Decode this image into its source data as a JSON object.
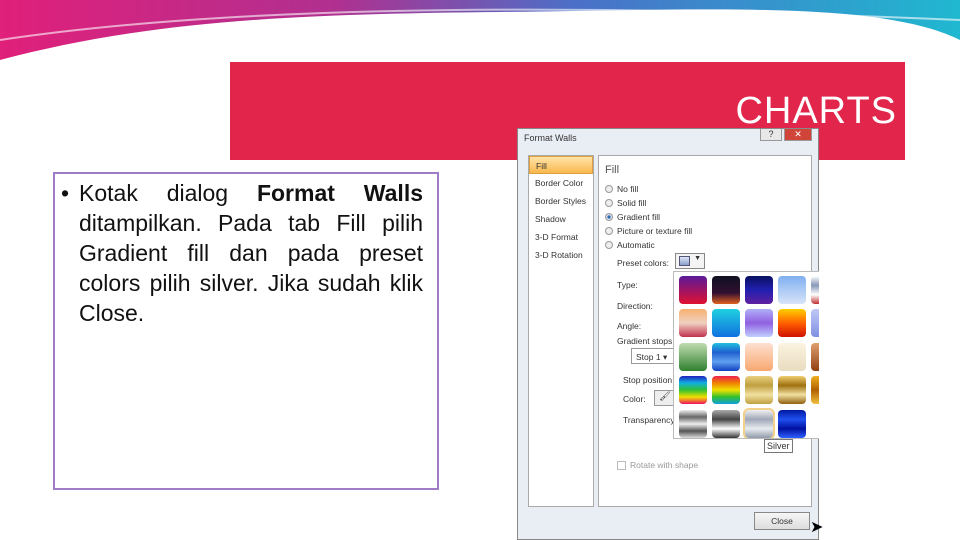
{
  "slide": {
    "title": "CHARTS",
    "bullet": {
      "p1": "Kotak dialog ",
      "b1": "Format Walls",
      "p2": " ",
      "b2": "ditampilkan. Pada tab Fill pilih ",
      "p3": "Gradient fill",
      "p4": " dan pada preset colors pilih silver. Jika sudah klik Close."
    }
  },
  "dialog": {
    "title": "Format Walls",
    "help": "?",
    "close_x": "✕",
    "nav": [
      "Fill",
      "Border Color",
      "Border Styles",
      "Shadow",
      "3-D Format",
      "3-D Rotation"
    ],
    "heading": "Fill",
    "radios": [
      "No fill",
      "Solid fill",
      "Gradient fill",
      "Picture or texture fill",
      "Automatic"
    ],
    "preset_label": "Preset colors:",
    "type_label": "Type:",
    "direction_label": "Direction:",
    "angle_label": "Angle:",
    "stops_label": "Gradient stops",
    "stop_value": "Stop 1",
    "stop_pos_label": "Stop position:",
    "color_label": "Color:",
    "transparency_label": "Transparency",
    "rotate_label": "Rotate with shape",
    "tooltip": "Silver",
    "close_button": "Close"
  },
  "colors": {
    "accent": "#e2254b",
    "border": "#a07cc8"
  }
}
